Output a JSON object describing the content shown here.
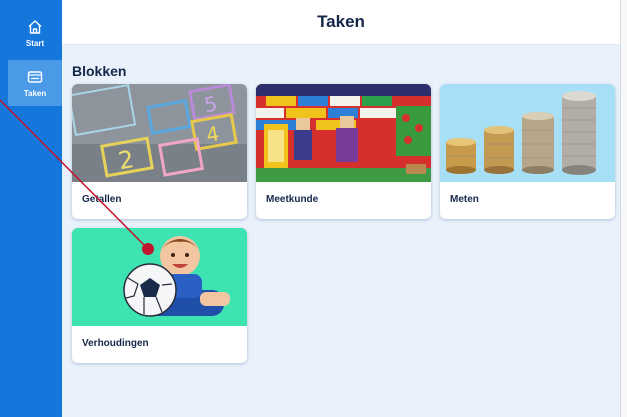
{
  "nav": {
    "items": [
      {
        "label": "Start",
        "icon": "home-icon"
      },
      {
        "label": "Taken",
        "icon": "tasks-icon",
        "active": true
      }
    ]
  },
  "header": {
    "title": "Taken"
  },
  "section": {
    "title": "Blokken"
  },
  "cards": [
    {
      "label": "Getallen",
      "image": "hopscotch-numbers-image"
    },
    {
      "label": "Meetkunde",
      "image": "lego-building-image"
    },
    {
      "label": "Meten",
      "image": "coin-stacks-image"
    },
    {
      "label": "Verhoudingen",
      "image": "child-with-football-image"
    }
  ],
  "colors": {
    "sidebar": "#1577dc",
    "background": "#e9f1fb",
    "text": "#15284a",
    "pointer": "#c0162e"
  }
}
